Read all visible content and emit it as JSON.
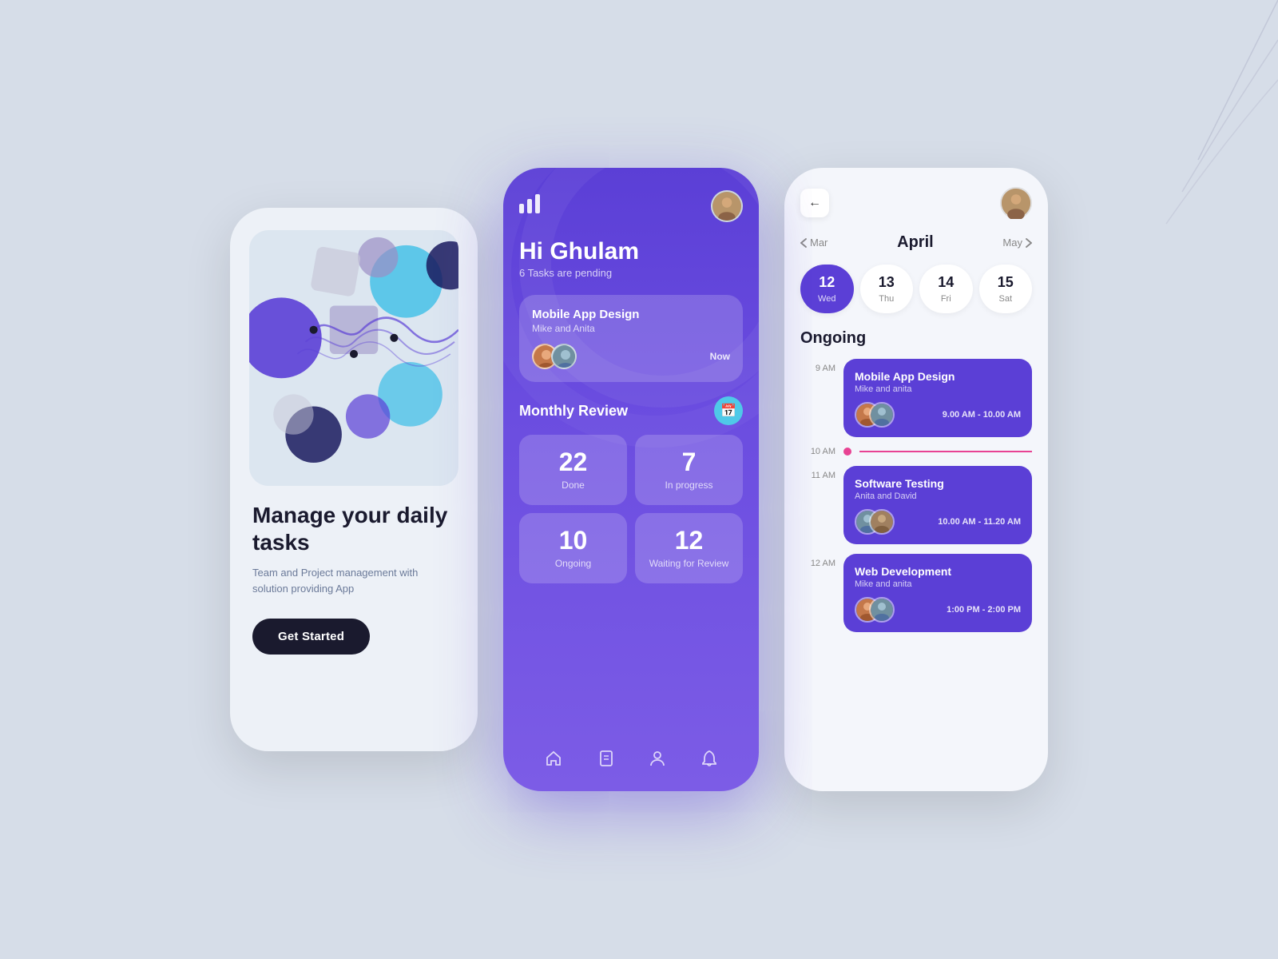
{
  "background": "#d6dde8",
  "phone1": {
    "title": "Manage your daily tasks",
    "subtitle": "Team and Project management with solution providing App",
    "btn_label": "Get Started"
  },
  "phone2": {
    "greeting": "Hi Ghulam",
    "tasks_pending": "6 Tasks are pending",
    "task": {
      "title": "Mobile App Design",
      "subtitle": "Mike and Anita",
      "time": "Now"
    },
    "monthly_review_label": "Monthly Review",
    "stats": [
      {
        "number": "22",
        "label": "Done"
      },
      {
        "number": "7",
        "label": "In progress"
      },
      {
        "number": "10",
        "label": "Ongoing"
      },
      {
        "number": "12",
        "label": "Waiting for Review"
      }
    ],
    "nav_icons": [
      "🏠",
      "📄",
      "👤",
      "🔔"
    ]
  },
  "phone3": {
    "month": "April",
    "prev_month": "Mar",
    "next_month": "May",
    "days": [
      {
        "num": "12",
        "label": "Wed",
        "active": true
      },
      {
        "num": "13",
        "label": "Thu",
        "active": false
      },
      {
        "num": "14",
        "label": "Fri",
        "active": false
      },
      {
        "num": "15",
        "label": "Sat",
        "active": false
      }
    ],
    "ongoing_label": "Ongoing",
    "schedule": [
      {
        "time": "9 AM",
        "card_title": "Mobile App Design",
        "card_sub": "Mike and anita",
        "card_time": "9.00 AM - 10.00 AM"
      },
      {
        "time": "10 AM",
        "is_timeline": true
      },
      {
        "time": "11 AM",
        "card_title": "Software Testing",
        "card_sub": "Anita and David",
        "card_time": "10.00 AM - 11.20 AM"
      },
      {
        "time": "12 AM",
        "card_title": "Web Development",
        "card_sub": "Mike and anita",
        "card_time": "1:00 PM - 2:00 PM"
      }
    ]
  }
}
